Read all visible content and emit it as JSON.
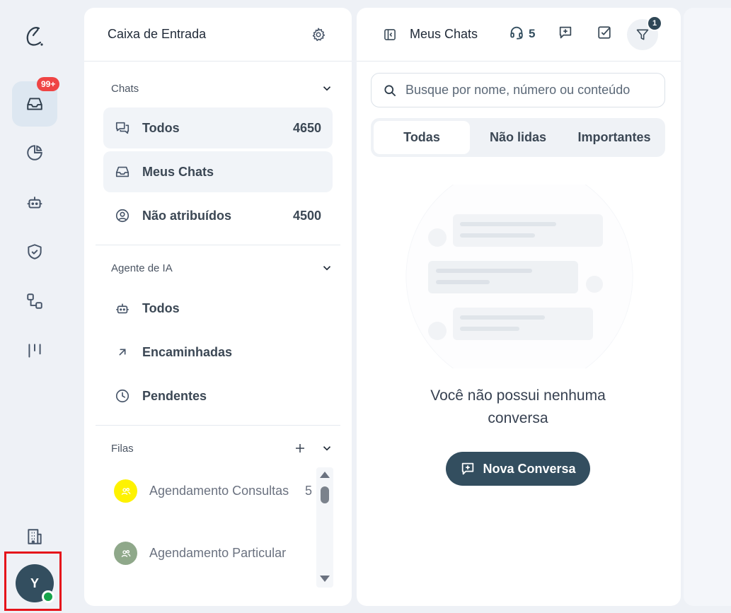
{
  "rail": {
    "inbox_badge": "99+",
    "user_initial": "Y",
    "items": [
      "inbox-icon",
      "pie-chart-icon",
      "bot-icon",
      "shield-check-icon",
      "workflow-icon",
      "kanban-icon",
      "building-icon"
    ]
  },
  "inbox": {
    "title": "Caixa de Entrada",
    "sections": {
      "chats": {
        "label": "Chats",
        "items": [
          {
            "label": "Todos",
            "count": "4650"
          },
          {
            "label": "Meus Chats",
            "count": ""
          },
          {
            "label": "Não atribuídos",
            "count": "4500"
          }
        ]
      },
      "agent": {
        "label": "Agente de IA",
        "items": [
          {
            "label": "Todos"
          },
          {
            "label": "Encaminhadas"
          },
          {
            "label": "Pendentes"
          }
        ]
      },
      "queues": {
        "label": "Filas",
        "items": [
          {
            "name": "Agendamento Consultas",
            "count": "5",
            "color": "#fef200"
          },
          {
            "name": "Agendamento Particular",
            "count": "",
            "color": "#8fa88a"
          }
        ]
      }
    }
  },
  "chats": {
    "title": "Meus Chats",
    "agents_online": "5",
    "filter_count": "1",
    "search_placeholder": "Busque por nome, número ou conteúdo",
    "tabs": [
      "Todas",
      "Não lidas",
      "Importantes"
    ],
    "empty_message": "Você não possui nenhuma conversa",
    "new_button": "Nova Conversa"
  },
  "colors": {
    "accent": "#334e5f",
    "badge": "#ef4444",
    "status": "#16a34a"
  }
}
